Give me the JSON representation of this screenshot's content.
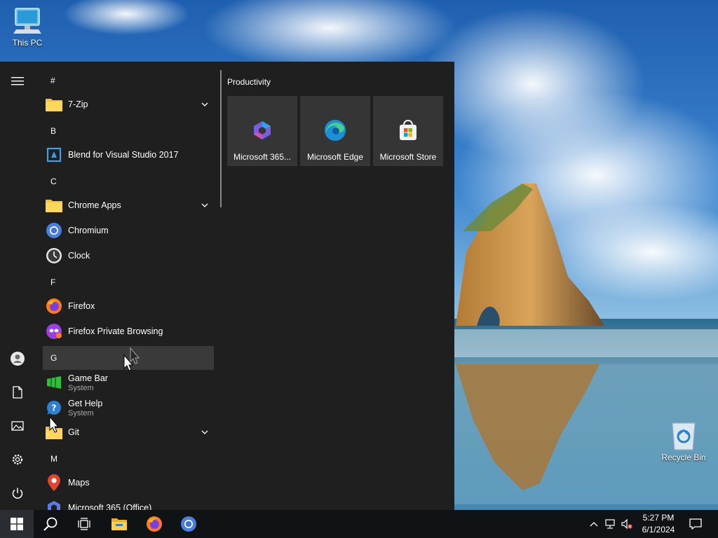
{
  "desktop": {
    "icons": [
      {
        "label": "This PC",
        "icon": "computer-icon"
      },
      {
        "label": "Recycle Bin",
        "icon": "recycle-bin-icon"
      }
    ]
  },
  "start_menu": {
    "rail": {
      "hamburger": "hamburger-menu-icon",
      "items": [
        "user-icon",
        "documents-icon",
        "pictures-icon",
        "settings-icon",
        "power-icon"
      ]
    },
    "groups": [
      {
        "letter": "#"
      },
      {
        "letter": "B"
      },
      {
        "letter": "C"
      },
      {
        "letter": "F"
      },
      {
        "letter": "G"
      },
      {
        "letter": "M"
      }
    ],
    "apps": [
      {
        "name": "7-Zip",
        "icon": "folder-icon"
      },
      {
        "name": "Blend for Visual Studio 2017",
        "icon": "blend-icon"
      },
      {
        "name": "Chrome Apps",
        "icon": "folder-icon"
      },
      {
        "name": "Chromium",
        "icon": "chromium-icon"
      },
      {
        "name": "Clock",
        "icon": "clock-icon"
      },
      {
        "name": "Firefox",
        "icon": "firefox-icon"
      },
      {
        "name": "Firefox Private Browsing",
        "icon": "firefox-private-icon"
      },
      {
        "name": "Game Bar",
        "sub": "System",
        "icon": "game-bar-icon"
      },
      {
        "name": "Get Help",
        "sub": "System",
        "icon": "get-help-icon"
      },
      {
        "name": "Git",
        "icon": "folder-icon"
      },
      {
        "name": "Maps",
        "icon": "maps-icon"
      },
      {
        "name": "Microsoft 365 (Office)",
        "icon": "microsoft-365-icon"
      }
    ],
    "tiles_group_title": "Productivity",
    "tiles": [
      {
        "name": "Microsoft 365...",
        "icon": "microsoft-365-icon"
      },
      {
        "name": "Microsoft Edge",
        "icon": "edge-icon"
      },
      {
        "name": "Microsoft Store",
        "icon": "store-icon"
      }
    ]
  },
  "taskbar": {
    "pinned": [
      "windows-start-icon",
      "search-icon",
      "task-view-icon",
      "file-explorer-icon",
      "firefox-icon",
      "chromium-icon"
    ],
    "tray": [
      "show-hidden-icons-chevron",
      "network-icon",
      "volume-muted-icon"
    ],
    "time": "5:27 PM",
    "date": "6/1/2024",
    "notification_icon": "action-center-icon"
  }
}
